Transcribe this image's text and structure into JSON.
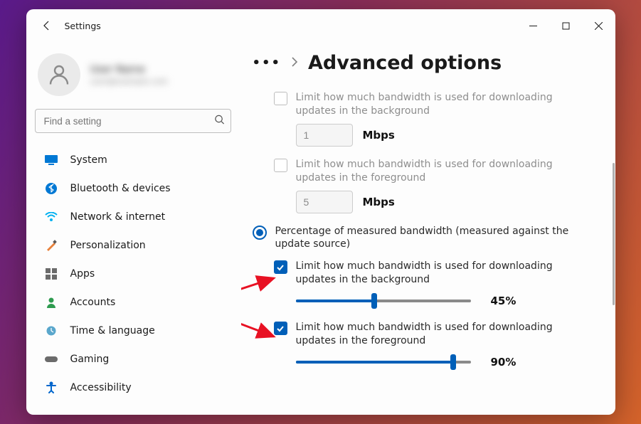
{
  "window": {
    "title": "Settings"
  },
  "profile": {
    "name": "User Name",
    "email": "user@example.com",
    "blurred": true
  },
  "search": {
    "placeholder": "Find a setting"
  },
  "sidebar": {
    "items": [
      {
        "label": "System",
        "icon": "system",
        "color": "#0078d4"
      },
      {
        "label": "Bluetooth & devices",
        "icon": "bluetooth",
        "color": "#0078d4"
      },
      {
        "label": "Network & internet",
        "icon": "wifi",
        "color": "#00b0f0"
      },
      {
        "label": "Personalization",
        "icon": "brush",
        "color": "#e8813b"
      },
      {
        "label": "Apps",
        "icon": "apps",
        "color": "#6b6b6b"
      },
      {
        "label": "Accounts",
        "icon": "person",
        "color": "#2e9b4f"
      },
      {
        "label": "Time & language",
        "icon": "globe-clock",
        "color": "#5aa7cc"
      },
      {
        "label": "Gaming",
        "icon": "gamepad",
        "color": "#6b6b6b"
      },
      {
        "label": "Accessibility",
        "icon": "accessibility",
        "color": "#0066cc"
      }
    ]
  },
  "breadcrumb": {
    "ellipsis": "…",
    "title": "Advanced options"
  },
  "options": {
    "bg_absolute": {
      "checked": false,
      "enabled": false,
      "label": "Limit how much bandwidth is used for downloading updates in the background",
      "value": "1",
      "unit": "Mbps"
    },
    "fg_absolute": {
      "checked": false,
      "enabled": false,
      "label": "Limit how much bandwidth is used for downloading updates in the foreground",
      "value": "5",
      "unit": "Mbps"
    },
    "percentage_radio": {
      "selected": true,
      "label": "Percentage of measured bandwidth (measured against the update source)"
    },
    "bg_percent": {
      "checked": true,
      "label": "Limit how much bandwidth is used for downloading updates in the background",
      "percent": 45,
      "display": "45%"
    },
    "fg_percent": {
      "checked": true,
      "label": "Limit how much bandwidth is used for downloading updates in the foreground",
      "percent": 90,
      "display": "90%"
    }
  },
  "annotation": {
    "type": "red-arrows-pointing-to-checkboxes"
  }
}
